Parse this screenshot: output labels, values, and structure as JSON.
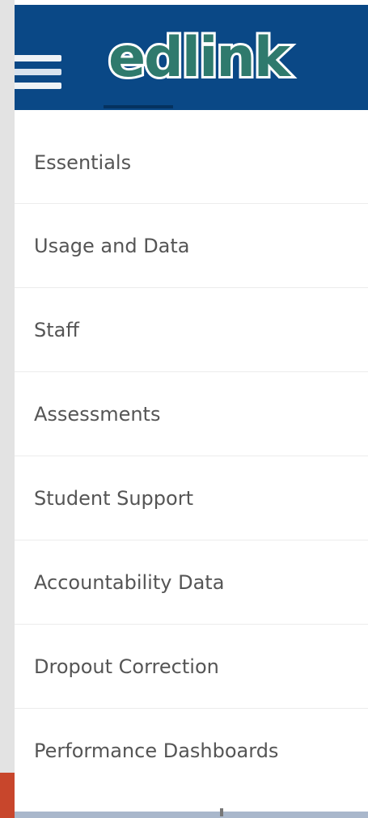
{
  "header": {
    "logo_text": "edlink",
    "menu_icon": "hamburger-menu-icon"
  },
  "menu": {
    "items": [
      {
        "label": "Essentials"
      },
      {
        "label": "Usage and Data"
      },
      {
        "label": "Staff"
      },
      {
        "label": "Assessments"
      },
      {
        "label": "Student Support"
      },
      {
        "label": "Accountability Data"
      },
      {
        "label": "Dropout Correction"
      },
      {
        "label": "Performance Dashboards"
      }
    ]
  },
  "colors": {
    "header_bg": "#0a4886",
    "logo_letters": "#2f7a6d",
    "logo_outline": "#ffffff",
    "menu_text": "#555555",
    "divider": "#ececec",
    "left_accent": "#c8462c"
  }
}
